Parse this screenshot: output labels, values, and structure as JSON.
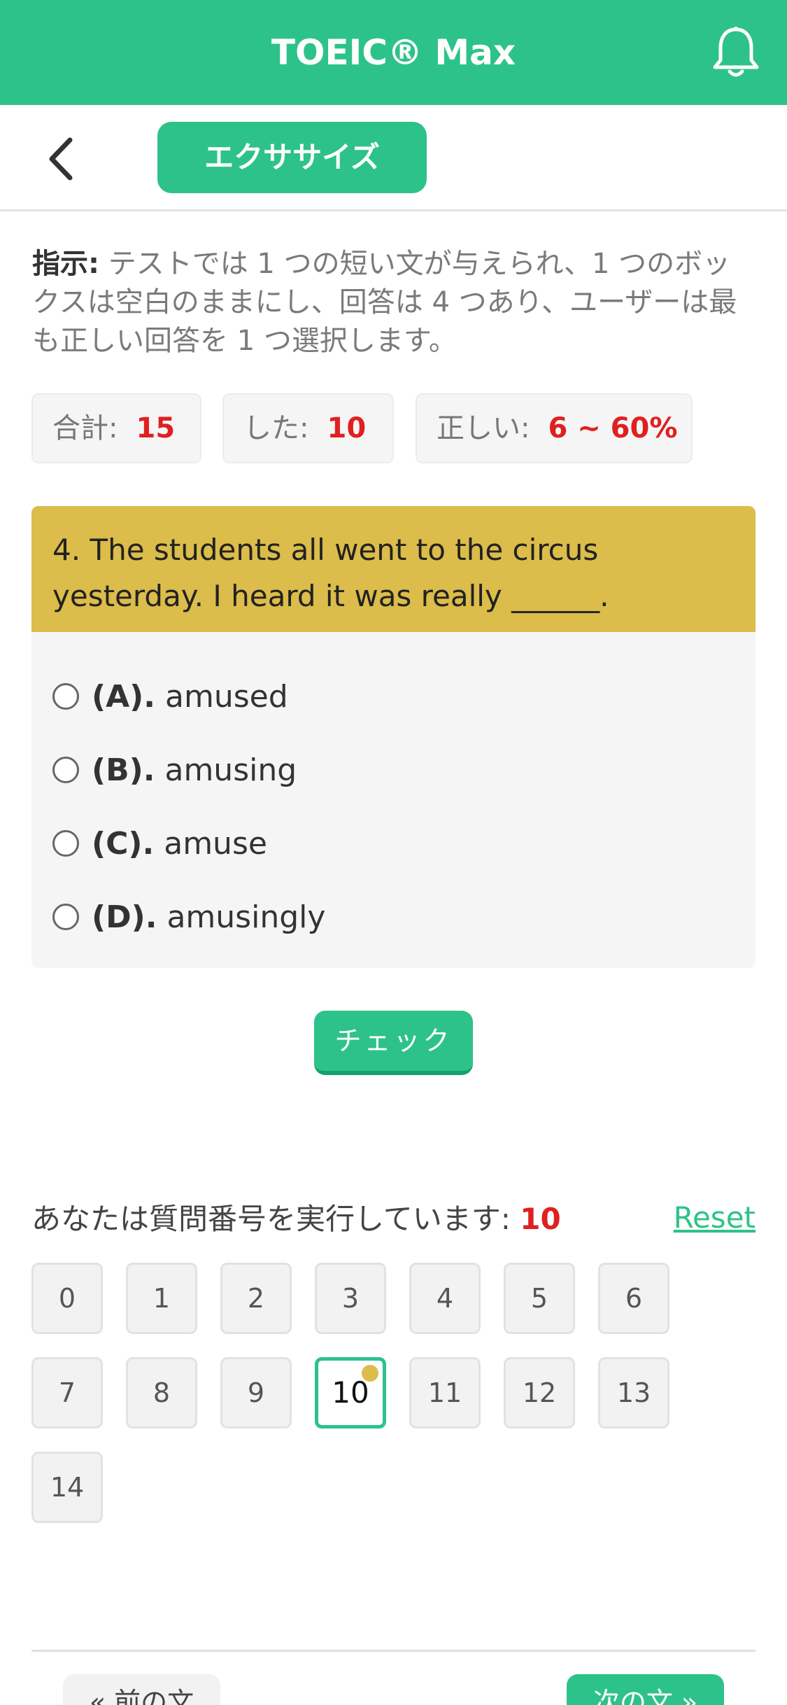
{
  "header": {
    "title": "TOEIC® Max",
    "bell_icon": "bell-icon",
    "back_icon": "chevron-left-icon",
    "section_tab": "エクササイズ",
    "accent_color": "#2ec28b"
  },
  "instructions": {
    "label": "指示:",
    "text": " テストでは 1 つの短い文が与えられ、1 つのボックスは空白のままにし、回答は 4 つあり、ユーザーは最も正しい回答を 1 つ選択します。"
  },
  "stats": {
    "total_label": "合計:",
    "total_value": "15",
    "done_label": "した:",
    "done_value": "10",
    "correct_label": "正しい:",
    "correct_value": "6 ~ 60%"
  },
  "question": {
    "text": "4. The students all went to the circus yesterday. I heard it was really ______.",
    "options": [
      {
        "letter": "(A).",
        "text": "amused"
      },
      {
        "letter": "(B).",
        "text": "amusing"
      },
      {
        "letter": "(C).",
        "text": "amuse"
      },
      {
        "letter": "(D).",
        "text": "amusingly"
      }
    ],
    "check_label": "チェック"
  },
  "progress": {
    "label": "あなたは質問番号を実行しています: ",
    "current": "10",
    "reset_label": "Reset",
    "numbers": [
      "0",
      "1",
      "2",
      "3",
      "4",
      "5",
      "6",
      "7",
      "8",
      "9",
      "10",
      "11",
      "12",
      "13",
      "14"
    ]
  },
  "footer": {
    "prev_label": "« 前の文",
    "next_label": "次の文 »"
  }
}
